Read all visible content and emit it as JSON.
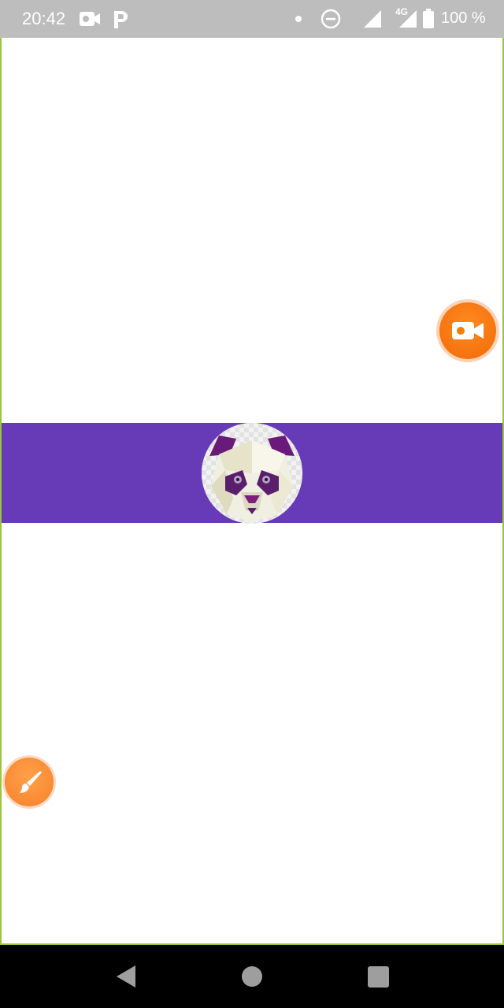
{
  "status_bar": {
    "time": "20:42",
    "battery_text": "100 %",
    "network_label": "4G",
    "icons": [
      "video-camera-icon",
      "parking-p-icon",
      "dot-icon",
      "do-not-disturb-icon",
      "signal-icon",
      "signal-4g-icon",
      "battery-icon"
    ]
  },
  "main": {
    "band_color": "#673ab7",
    "avatar": "panda-avatar"
  },
  "fabs": {
    "video": {
      "icon": "video-camera-icon",
      "color": "#f57c00"
    },
    "brush": {
      "icon": "paintbrush-icon",
      "color": "#ff9a4a"
    }
  },
  "nav_bar": {
    "buttons": [
      "back-icon",
      "home-icon",
      "recents-icon"
    ]
  }
}
